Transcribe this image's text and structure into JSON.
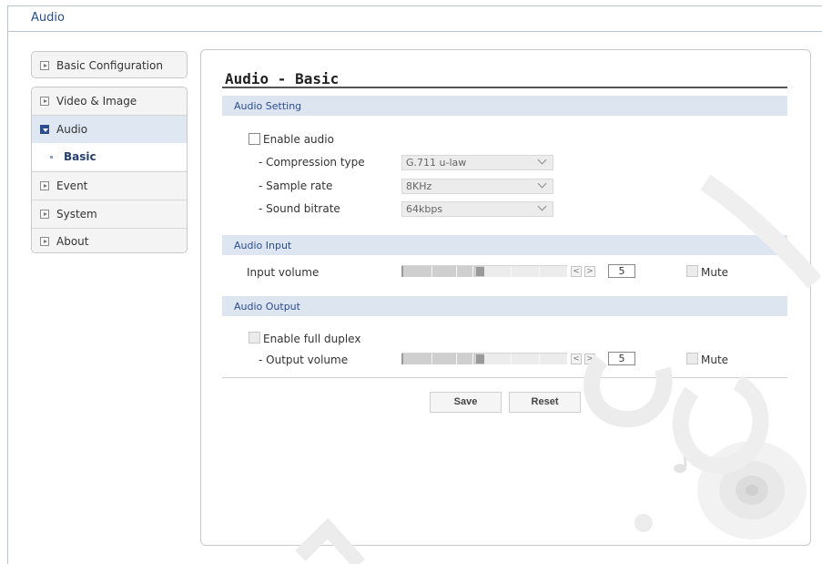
{
  "header": {
    "title": "Audio"
  },
  "sidebar": {
    "group1": [
      {
        "label": "Basic Configuration"
      }
    ],
    "group2": [
      {
        "label": "Video & Image"
      },
      {
        "label": "Audio"
      },
      {
        "label": "Basic"
      },
      {
        "label": "Event"
      },
      {
        "label": "System"
      },
      {
        "label": "About"
      }
    ]
  },
  "main": {
    "title": "Audio - Basic",
    "audio_setting": {
      "heading": "Audio Setting",
      "enable_audio_label": "Enable audio",
      "compression_label": "- Compression type",
      "compression_value": "G.711 u-law",
      "sample_rate_label": "- Sample rate",
      "sample_rate_value": "8KHz",
      "bitrate_label": "- Sound bitrate",
      "bitrate_value": "64kbps"
    },
    "audio_input": {
      "heading": "Audio Input",
      "volume_label": "Input volume",
      "volume_value": "5",
      "volume_level": 0.5,
      "mute_label": "Mute",
      "dec": "<",
      "inc": ">"
    },
    "audio_output": {
      "heading": "Audio Output",
      "duplex_label": "Enable full duplex",
      "volume_label": "- Output volume",
      "volume_value": "5",
      "volume_level": 0.5,
      "mute_label": "Mute",
      "dec": "<",
      "inc": ">"
    },
    "buttons": {
      "save": "Save",
      "reset": "Reset"
    }
  },
  "colors": {
    "accent": "#2b4d90",
    "section_bg": "#dde5f1",
    "active_nav": "#dfe7f3"
  }
}
